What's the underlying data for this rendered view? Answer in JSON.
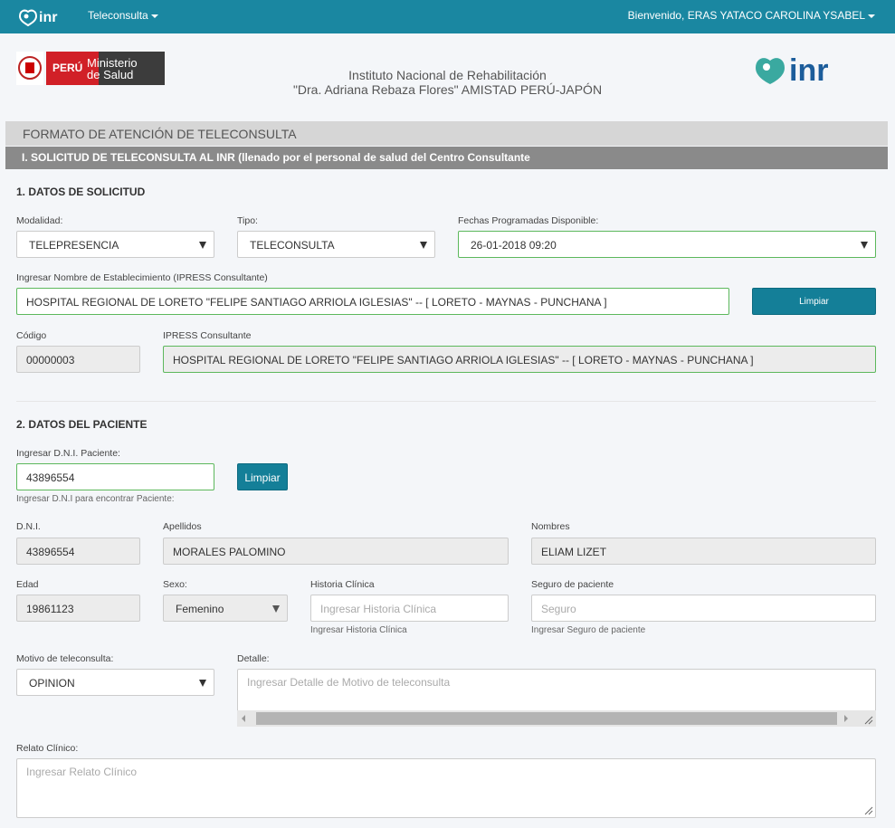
{
  "navbar": {
    "menu_label": "Teleconsulta",
    "user_label": "Bienvenido, ERAS YATACO CAROLINA YSABEL"
  },
  "header": {
    "minsa_country": "PERÚ",
    "minsa_line1": "Ministerio",
    "minsa_line2": "de Salud",
    "institution_line1": "Instituto Nacional de Rehabilitación",
    "institution_line2": "\"Dra. Adriana Rebaza Flores\" AMISTAD PERÚ-JAPÓN"
  },
  "form": {
    "title": "FORMATO DE ATENCIÓN DE TELECONSULTA",
    "subtitle": "I. SOLICITUD DE TELECONSULTA AL INR (llenado por el personal de salud del Centro Consultante"
  },
  "solicitud": {
    "title": "1. DATOS DE SOLICITUD",
    "modalidad_label": "Modalidad:",
    "modalidad_value": "TELEPRESENCIA",
    "tipo_label": "Tipo:",
    "tipo_value": "TELECONSULTA",
    "fechas_label": "Fechas Programadas Disponible:",
    "fechas_value": "26-01-2018 09:20",
    "establecimiento_label": "Ingresar Nombre de Establecimiento (IPRESS Consultante)",
    "establecimiento_value": "HOSPITAL REGIONAL DE LORETO \"FELIPE SANTIAGO ARRIOLA IGLESIAS\" -- [ LORETO - MAYNAS - PUNCHANA ]",
    "limpiar_label": "Limpiar",
    "codigo_label": "Código",
    "codigo_value": "00000003",
    "ipress_label": "IPRESS Consultante",
    "ipress_value": "HOSPITAL REGIONAL DE LORETO \"FELIPE SANTIAGO ARRIOLA IGLESIAS\" -- [ LORETO - MAYNAS - PUNCHANA ]"
  },
  "paciente": {
    "title": "2. DATOS DEL PACIENTE",
    "dni_input_label": "Ingresar D.N.I. Paciente:",
    "dni_input_value": "43896554",
    "dni_help": "Ingresar D.N.I para encontrar Paciente:",
    "limpiar_label": "Limpiar",
    "dni_label": "D.N.I.",
    "dni_value": "43896554",
    "apellidos_label": "Apellidos",
    "apellidos_value": "MORALES PALOMINO",
    "nombres_label": "Nombres",
    "nombres_value": "ELIAM LIZET",
    "edad_label": "Edad",
    "edad_value": "19861123",
    "sexo_label": "Sexo:",
    "sexo_value": "Femenino",
    "historia_label": "Historia Clínica",
    "historia_placeholder": "Ingresar Historia Clínica",
    "historia_help": "Ingresar Historia Clínica",
    "seguro_label": "Seguro de paciente",
    "seguro_placeholder": "Seguro",
    "seguro_help": "Ingresar Seguro de paciente",
    "motivo_label": "Motivo de teleconsulta:",
    "motivo_value": "OPINION",
    "detalle_label": "Detalle:",
    "detalle_placeholder": "Ingresar Detalle de Motivo de teleconsulta",
    "relato_label": "Relato Clínico:",
    "relato_placeholder": "Ingresar Relato Clínico"
  },
  "colors": {
    "navbar": "#1a87a1",
    "button": "#147f98",
    "valid_border": "#5cb85c",
    "section_dark": "#8a8a8a",
    "section_light": "#d6d6d6"
  }
}
